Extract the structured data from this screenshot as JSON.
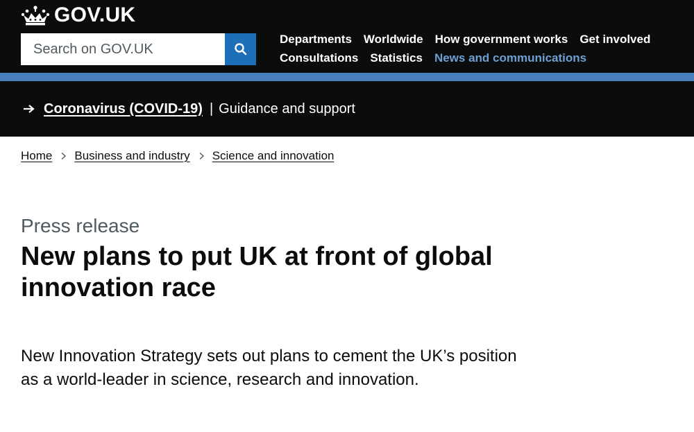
{
  "header": {
    "logo_text": "GOV.UK",
    "crown_icon": "crown-icon",
    "search": {
      "placeholder": "Search on GOV.UK",
      "value": "",
      "button_icon": "search-icon"
    },
    "nav": {
      "row1": [
        "Departments",
        "Worldwide",
        "How government works",
        "Get involved"
      ],
      "row2": [
        "Consultations",
        "Statistics",
        "News and communications"
      ],
      "active_item": "News and communications"
    },
    "colors": {
      "header_bg": "#0b0c0c",
      "accent_bar": "#4a7fbd",
      "search_button": "#1d70b8",
      "active_link": "#6f9fd4"
    }
  },
  "banner": {
    "arrow_icon": "arrow-right-icon",
    "link": "Coronavirus (COVID-19)",
    "separator": "|",
    "text": "Guidance and support"
  },
  "breadcrumb": {
    "items": [
      "Home",
      "Business and industry",
      "Science and innovation"
    ],
    "separator_icon": "chevron-right-icon"
  },
  "content": {
    "caption": "Press release",
    "title": "New plans to put UK at front of global innovation race",
    "lead": "New Innovation Strategy sets out plans to cement the UK’s position as a world-leader in science, research and innovation."
  }
}
